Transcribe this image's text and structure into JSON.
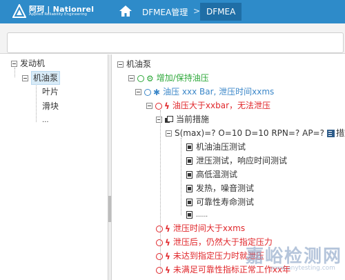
{
  "header": {
    "logo_text": "阿珂 | Nationrel",
    "logo_sub": "Applied Reliability Engineering",
    "breadcrumb": [
      "DFMEA管理",
      "DFMEA"
    ],
    "separator": ">"
  },
  "left_tree": {
    "root": "发动机",
    "selected": "机油泵",
    "children": [
      "叶片",
      "滑块",
      "..."
    ]
  },
  "right_tree": {
    "root": "机油泵",
    "function_1": "增加/保持油压",
    "function_2": "油压 xxx Bar, 泄压时间xxms",
    "failure_1": "油压大于xxbar，无法泄压",
    "current_measures": "当前措施",
    "rating": "S(max)=? O=10 D=10 RPN=? AP=?",
    "measure_group": "措施组",
    "measures": [
      "机油油压测试",
      "泄压测试，响应时间测试",
      "高低温测试",
      "发热，噪音测试",
      "可靠性寿命测试",
      "......"
    ],
    "failures": [
      "泄压时间大于xxms",
      "泄压后，仍然大于指定压力",
      "未达到指定压力时就泄压",
      "未满足可靠性指标正常工作xx年"
    ]
  },
  "watermark": {
    "main": "嘉峪检测网",
    "sub": "www.anytesting.com"
  },
  "colors": {
    "header_bg": "#2e8bc9",
    "active_crumb": "#1f6ea6",
    "function_green": "#2ea83a",
    "function_blue": "#3a86c8",
    "failure_red": "#e0262a"
  }
}
